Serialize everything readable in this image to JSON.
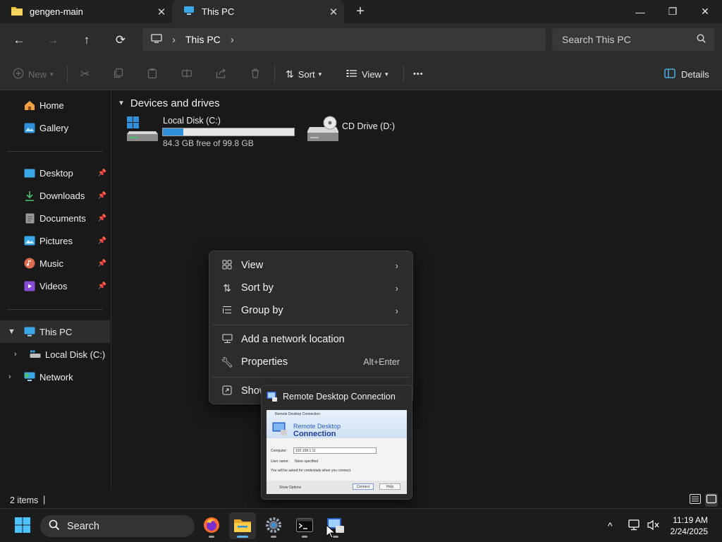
{
  "tabs": [
    {
      "label": "gengen-main",
      "close": "✕"
    },
    {
      "label": "This PC",
      "close": "✕"
    }
  ],
  "new_tab": "+",
  "window_controls": {
    "minimize": "—",
    "maximize": "❐",
    "close": "✕"
  },
  "nav": {
    "back": "←",
    "forward": "→",
    "up": "↑",
    "refresh": "⟳",
    "breadcrumb_sep": "›",
    "breadcrumb": [
      "This PC"
    ],
    "trailing_sep": "›"
  },
  "search": {
    "placeholder": "Search This PC"
  },
  "commandbar": {
    "new_label": "New",
    "sort_label": "Sort",
    "view_label": "View",
    "more": "•••",
    "details_label": "Details"
  },
  "sidebar": {
    "top": [
      {
        "label": "Home",
        "icon": "home-icon"
      },
      {
        "label": "Gallery",
        "icon": "gallery-icon"
      }
    ],
    "quick": [
      {
        "label": "Desktop",
        "icon": "desktop-icon"
      },
      {
        "label": "Downloads",
        "icon": "downloads-icon"
      },
      {
        "label": "Documents",
        "icon": "documents-icon"
      },
      {
        "label": "Pictures",
        "icon": "pictures-icon"
      },
      {
        "label": "Music",
        "icon": "music-icon"
      },
      {
        "label": "Videos",
        "icon": "videos-icon"
      }
    ],
    "tree": [
      {
        "label": "This PC",
        "icon": "this-pc-icon",
        "expanded": true
      },
      {
        "label": "Local Disk (C:)",
        "icon": "drive-icon",
        "expanded": false
      },
      {
        "label": "Network",
        "icon": "network-icon",
        "expanded": false
      }
    ]
  },
  "content": {
    "group_header": "Devices and drives",
    "drives": [
      {
        "name": "Local Disk (C:)",
        "free_text": "84.3 GB free of 99.8 GB",
        "used_fraction": 0.155
      },
      {
        "name": "CD Drive (D:)"
      }
    ]
  },
  "status": {
    "items": "2 items",
    "separator": "|"
  },
  "context_menu": {
    "items": [
      {
        "label": "View",
        "icon": "grid-icon",
        "submenu": true
      },
      {
        "label": "Sort by",
        "icon": "sort-icon",
        "submenu": true
      },
      {
        "label": "Group by",
        "icon": "group-icon",
        "submenu": true
      },
      {
        "label": "Add a network location",
        "icon": "network-location-icon"
      },
      {
        "label": "Properties",
        "icon": "wrench-icon",
        "accelerator": "Alt+Enter"
      },
      {
        "label": "Show",
        "icon": "show-more-icon"
      }
    ],
    "arrow": "›"
  },
  "taskbar_preview": {
    "title": "Remote Desktop Connection",
    "thumb": {
      "window_title": "Remote Desktop Connection",
      "heading_line1": "Remote Desktop",
      "heading_line2": "Connection",
      "computer_label": "Computer:",
      "computer_value": "192.168.1.11",
      "user_label": "User name:",
      "user_value": "None specified",
      "note": "You will be asked for credentials when you connect.",
      "show_options": "Show Options",
      "connect": "Connect",
      "help": "Help"
    }
  },
  "taskbar": {
    "search_label": "Search",
    "tray_arrow": "^",
    "time": "11:19 AM",
    "date": "2/24/2025"
  },
  "colors": {
    "accent": "#4cc2ff",
    "capacity_fill": "#2f8fd8"
  }
}
